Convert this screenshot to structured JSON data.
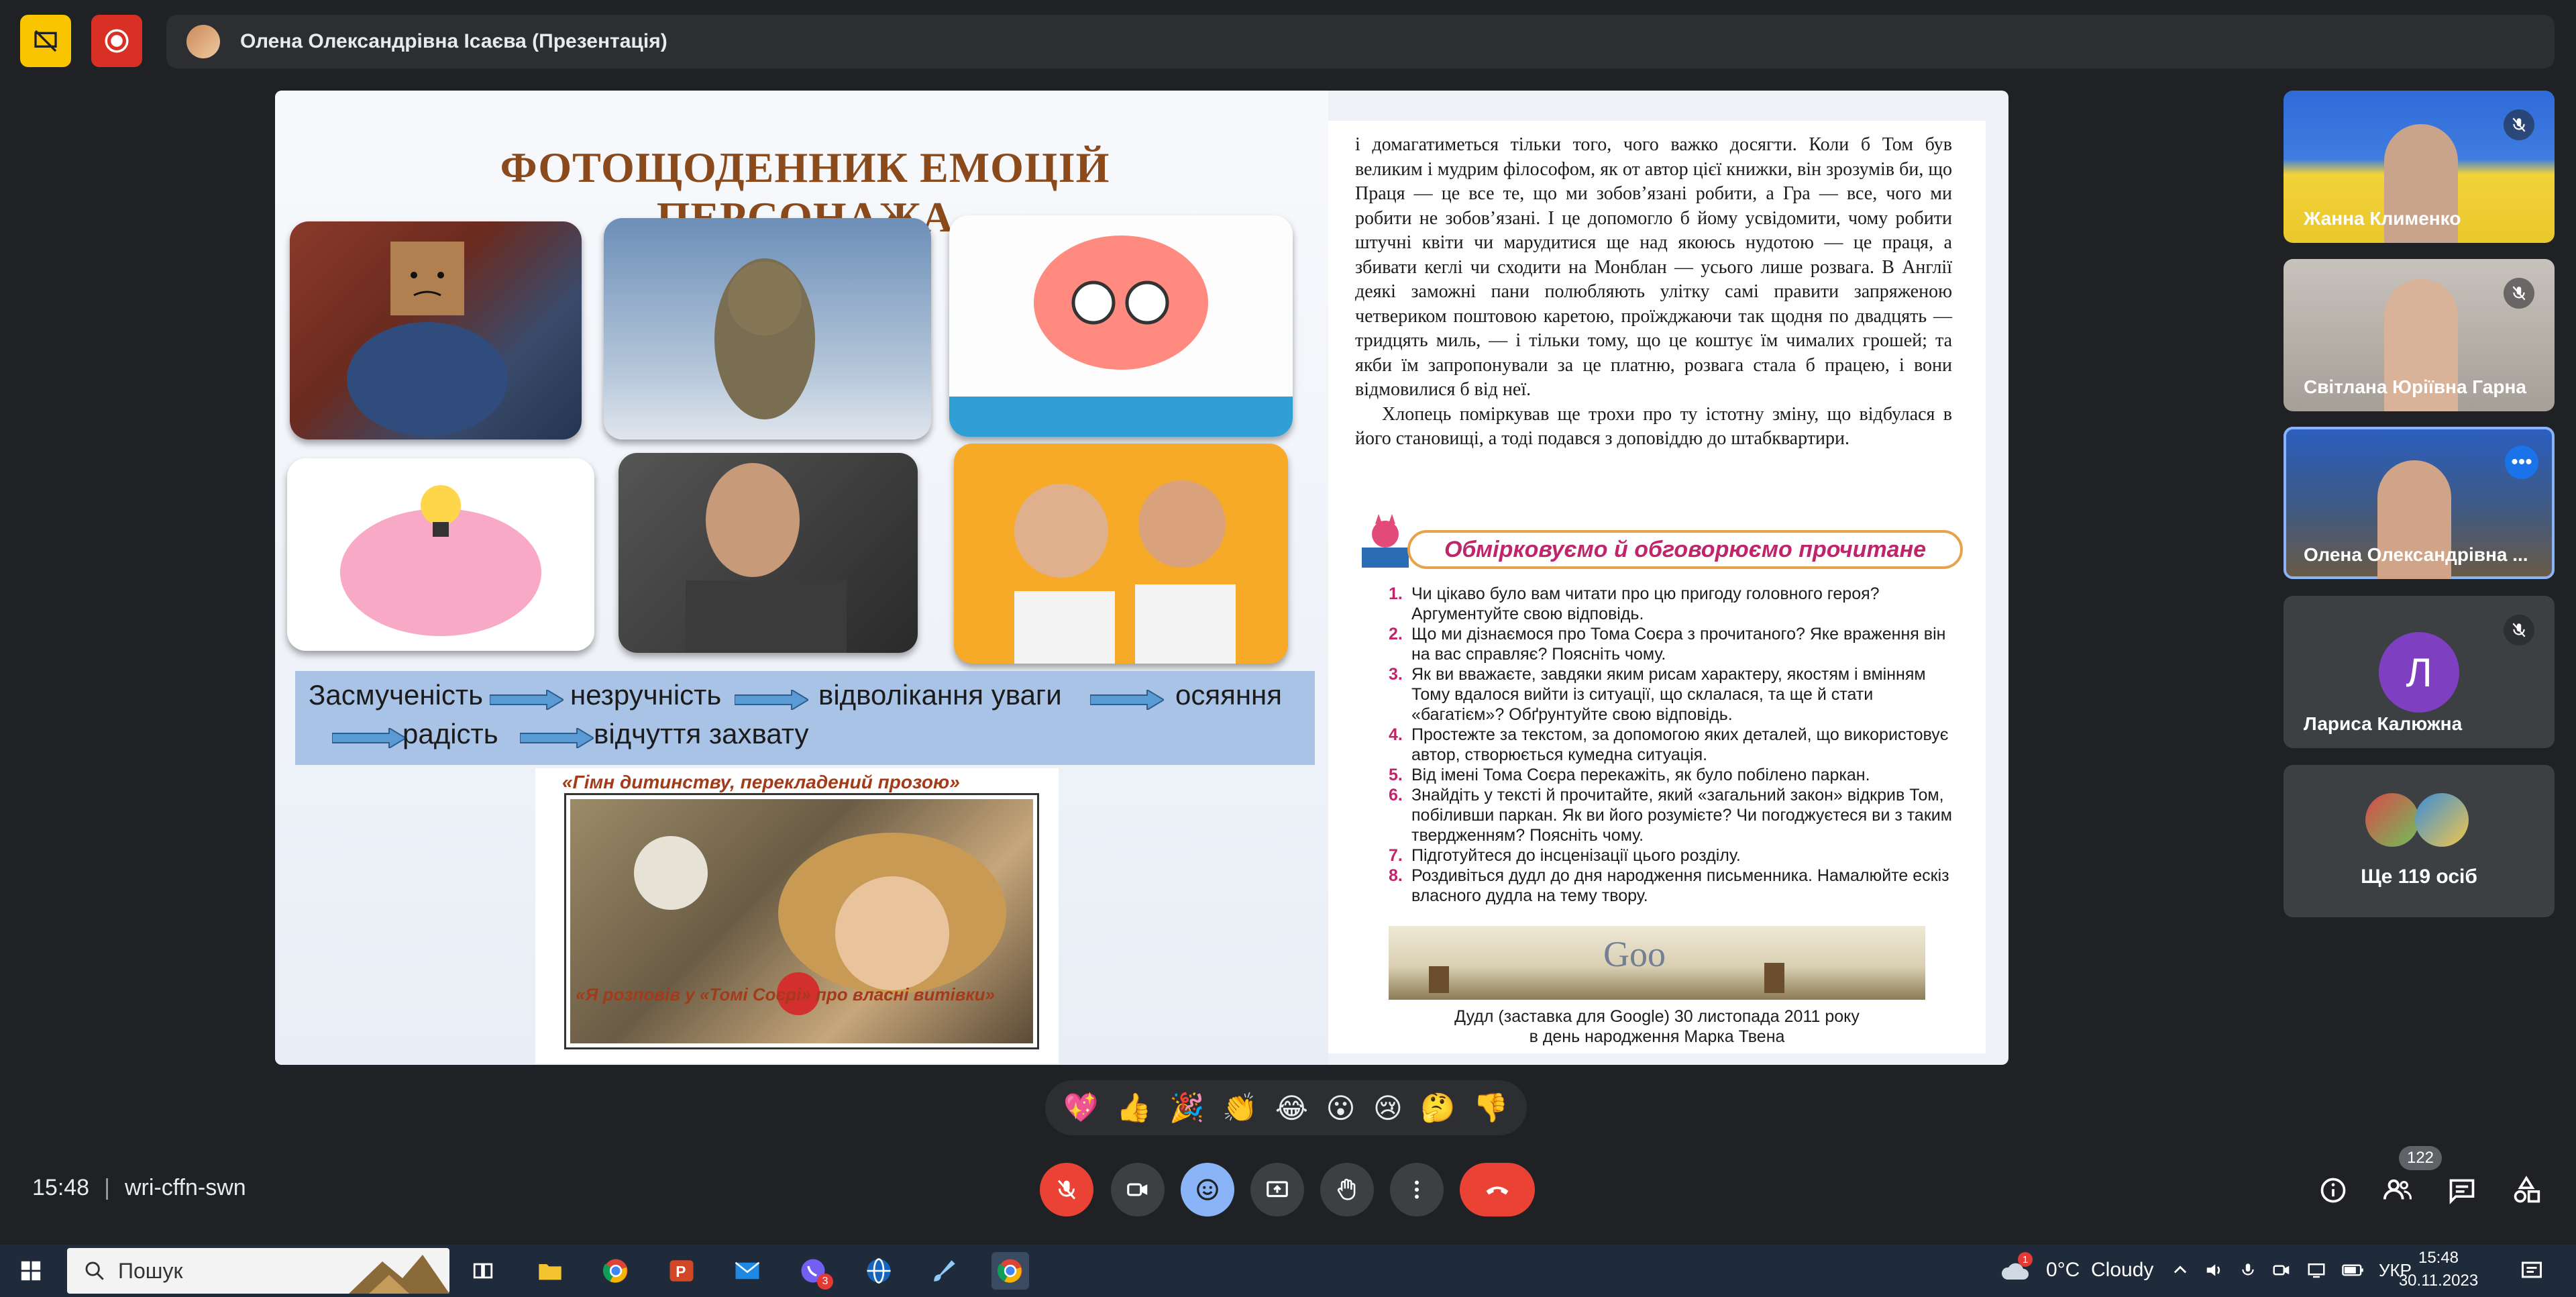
{
  "top_bar": {
    "presenter_name": "Олена Олександрівна Ісаєва (Презентація)"
  },
  "slide": {
    "title": "ФОТОЩОДЕННИК ЕМОЦІЙ ПЕРСОНАЖА",
    "emotion_chain": [
      "Засмученість",
      "незручність",
      "відволікання уваги",
      "осяяння",
      "радість",
      "відчуття захвату"
    ],
    "book_image": {
      "top_caption": "«Гімн дитинству, перекладений прозою»",
      "bottom_caption": "«Я розповів у «Томі Соєрі» про власні витівки»"
    },
    "page": {
      "paragraph1": "і домагатиметься тільки того, чого важко досягти. Коли б Том був великим і мудрим філософом, як от автор цієї книжки, він зрозумів би, що Праця — це все те, що ми зобов’язані робити, а Гра — все, чого ми робити не зобов’язані. І це допомогло б йому усвідомити, чому робити штучні квіти чи марудитися ще над якоюсь нудотою — це праця, а збивати кеглі чи сходити на Монблан — усього лише розвага. В Англії деякі заможні пани полюбляють улітку самі правити запряженою четвериком поштовою каретою, проїжджаючи так щодня по двадцять — тридцять миль, — і тільки тому, що це коштує їм чималих грошей; та якби їм запропонували за це платню, розвага стала б працею, і вони відмовилися б від неї.",
      "paragraph2": "Хлопець поміркував ще трохи про ту істотну зміну, що відбулася в його становищі, а тоді подався з доповіддю до штабквартири.",
      "heading": "Обмірковуємо й обговорюємо прочитане",
      "questions": [
        {
          "n": "1.",
          "text": "Чи цікаво було вам читати про цю пригоду головного героя? Аргументуйте свою відповідь."
        },
        {
          "n": "2.",
          "text": "Що ми дізнаємося про Тома Соєра з прочитаного? Яке враження він на вас справляє? Поясніть чому."
        },
        {
          "n": "3.",
          "text": "Як ви вважаєте, завдяки яким рисам характеру, якостям і вмінням Тому вдалося вийти із ситуації, що склалася, та ще й стати «багатієм»? Обґрунтуйте свою відповідь."
        },
        {
          "n": "4.",
          "text": "Простежте за текстом, за допомогою яких деталей, що використовує автор, створюється кумедна ситуація."
        },
        {
          "n": "5.",
          "text": "Від імені Тома Соєра перекажіть, як було побілено паркан."
        },
        {
          "n": "6.",
          "text": "Знайдіть у тексті й прочитайте, який «загальний закон» відкрив Том, побіливши паркан. Як ви його розумієте? Чи погоджуєтеся ви з таким твердженням? Поясніть чому."
        },
        {
          "n": "7.",
          "text": "Підготуйтеся до інсценізації цього розділу."
        },
        {
          "n": "8.",
          "text": "Роздивіться дудл до дня народження письменника. Намалюйте ескіз власного дудла на тему твору."
        }
      ],
      "doodle_caption_1": "Дудл (заставка для Google) 30 листопада 2011 року",
      "doodle_caption_2": "в день народження Марка Твена"
    }
  },
  "participants": [
    {
      "name": "Жанна Клименко"
    },
    {
      "name": "Світлана Юріївна Гарна"
    },
    {
      "name": "Олена Олександрівна ..."
    },
    {
      "name": "Лариса Калюжна",
      "initial": "Л"
    },
    {
      "name": "Ще 119 осіб"
    }
  ],
  "reactions": [
    "💖",
    "👍",
    "🎉",
    "👏",
    "😂",
    "😮",
    "😢",
    "🤔",
    "👎"
  ],
  "bottom_bar": {
    "time": "15:48",
    "meeting_code": "wri-cffn-swn",
    "people_count": "122"
  },
  "taskbar": {
    "search_placeholder": "Пошук",
    "weather": "0°C  Cloudy",
    "weather_badge": "1",
    "language": "УКР",
    "time": "15:48",
    "date": "30.11.2023",
    "viber_badge": "3"
  }
}
